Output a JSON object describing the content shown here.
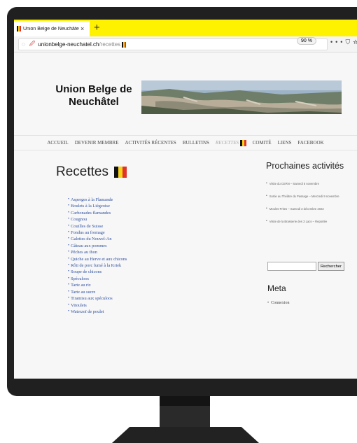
{
  "browser": {
    "tab_title": "Union Belge de Neuchâtel | St",
    "tab_close": "×",
    "new_tab": "+",
    "url_domain": "unionbelge-neuchatel.ch",
    "url_path": "/recettes",
    "zoom": "90 %",
    "more_icon": "•••",
    "pocket_icon": "⛉",
    "bookmark_icon": "☆"
  },
  "site": {
    "title": "Union Belge de Neuchâtel"
  },
  "nav": [
    "ACCUEIL",
    "DEVENIR MEMBRE",
    "ACTIVITÉS RÉCENTES",
    "BULLETINS",
    "RECETTES",
    "COMITÉ",
    "LIENS",
    "FACEBOOK"
  ],
  "main": {
    "heading": "Recettes",
    "recipes": [
      "Asperges à la Flamande",
      "Boulets à la Liégeoise",
      "Carbonades flamandes",
      "Cougnou",
      "Couilles de Suisse",
      "Fondus au fromage",
      "Galettes du Nouvel-An",
      "Gâteau aux pommes",
      "Pêches au thon",
      "Quiche au Herve et aux chicons",
      "Rôti de porc fumé à la Kriek",
      "Soupe de chicons",
      "Spéculoos",
      "Tarte au riz",
      "Tarte au sucre",
      "Tiramisu aux spéculoos",
      "Vitoulets",
      "Waterzoï de poulet"
    ]
  },
  "sidebar": {
    "activities_heading": "Prochaines activités",
    "events": [
      "Visite du CERN – Samedi 5 novembre",
      "Sortie au Théâtre du Passage – Mercredi 9 novembre",
      "Moules-Frites – Samedi 3 décembre 2022",
      "Visite de la Brasserie des 3 Lacs – Reportée"
    ],
    "search_button": "Rechercher",
    "meta_heading": "Meta",
    "meta_items": [
      "Connexion"
    ]
  },
  "colors": {
    "tab_bar": "#fff200",
    "link": "#2d4fa0",
    "flag": [
      "#111111",
      "#f6d21a",
      "#e0332a"
    ]
  }
}
